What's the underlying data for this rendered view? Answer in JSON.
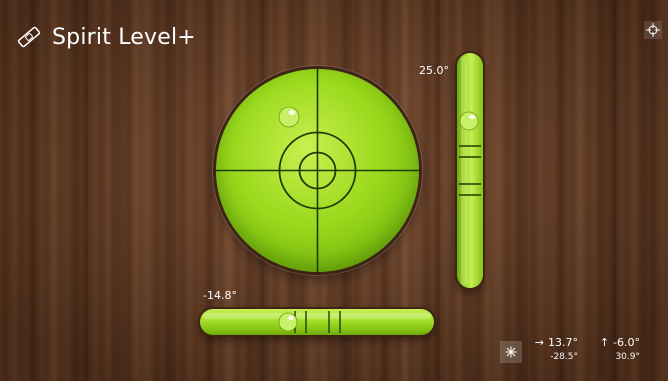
{
  "app": {
    "title": "Spirit Level+"
  },
  "icons": {
    "app_icon": "level-icon",
    "settings_icon": "crosshair-settings-icon",
    "calibrate_icon": "snowflake-icon",
    "arrow_right": "→",
    "arrow_up": "↑"
  },
  "levels": {
    "vertical": {
      "angle_label": "25.0°"
    },
    "horizontal": {
      "angle_label": "-14.8°"
    }
  },
  "readouts": {
    "x": {
      "value": "13.7°",
      "secondary": "-28.5°"
    },
    "y": {
      "value": "-6.0°",
      "secondary": "30.9°"
    }
  },
  "colors": {
    "bubble_green": "#9ad91c",
    "wood": "#6e4024",
    "text": "#ffffff"
  }
}
